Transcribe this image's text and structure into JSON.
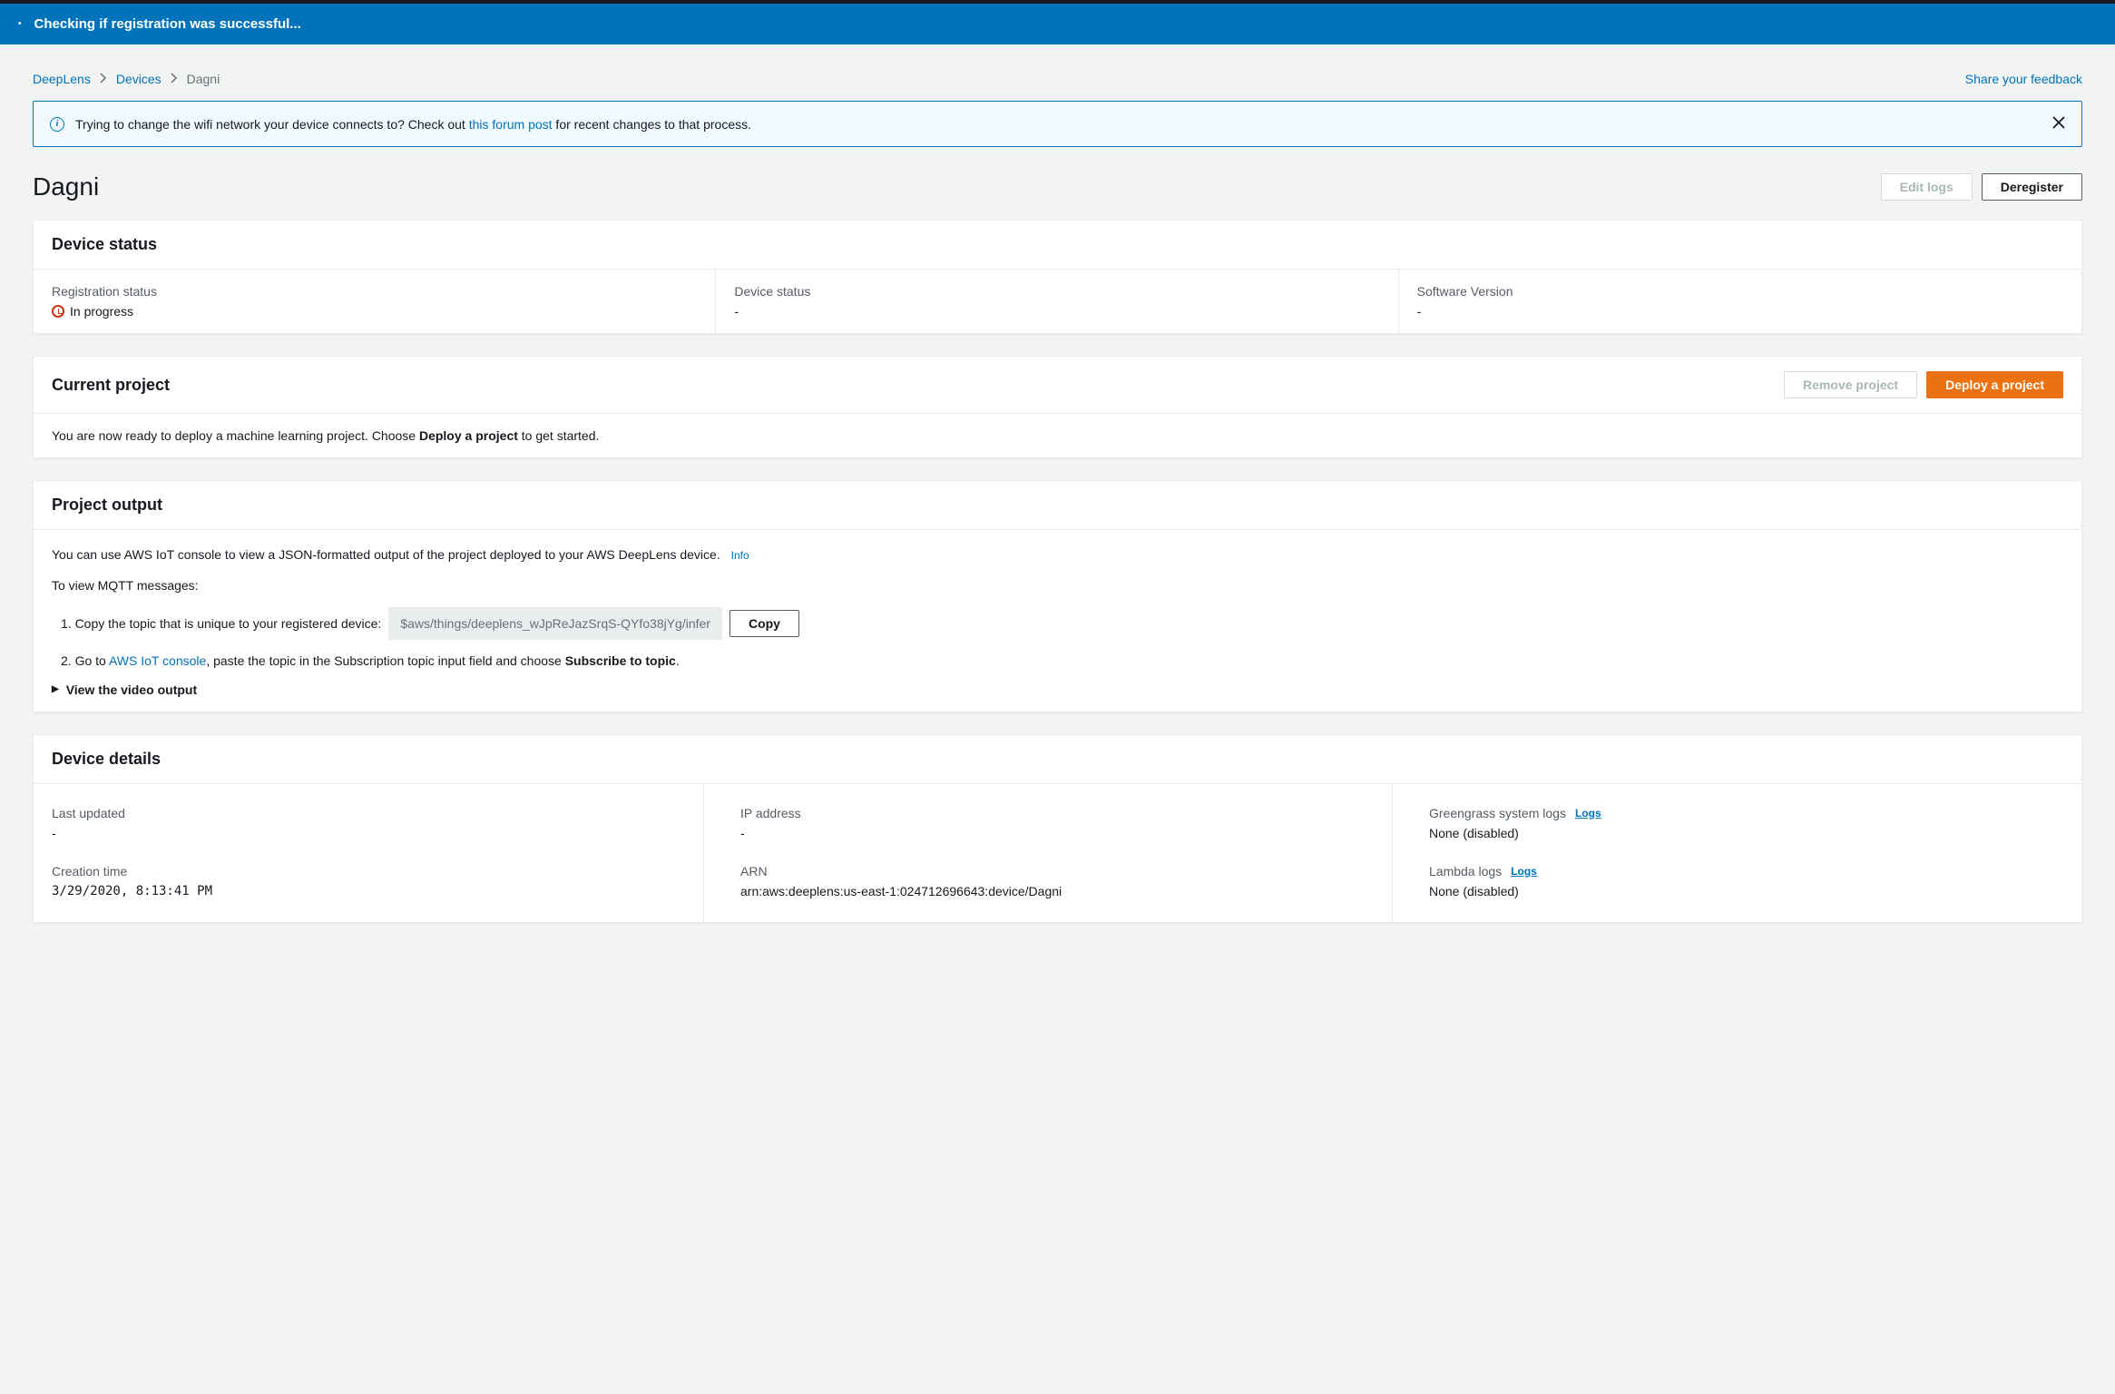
{
  "banner": {
    "message": "Checking if registration was successful..."
  },
  "breadcrumb": {
    "root": "DeepLens",
    "devices": "Devices",
    "current": "Dagni",
    "feedback": "Share your feedback"
  },
  "alert": {
    "text_pre": "Trying to change the wifi network your device connects to? Check out ",
    "link": "this forum post",
    "text_post": " for recent changes to that process."
  },
  "page": {
    "title": "Dagni",
    "edit_logs": "Edit logs",
    "deregister": "Deregister"
  },
  "device_status": {
    "title": "Device status",
    "registration_label": "Registration status",
    "registration_value": "In progress",
    "device_label": "Device status",
    "device_value": "-",
    "software_label": "Software Version",
    "software_value": "-"
  },
  "current_project": {
    "title": "Current project",
    "remove": "Remove project",
    "deploy": "Deploy a project",
    "msg_pre": "You are now ready to deploy a machine learning project. Choose ",
    "msg_bold": "Deploy a project",
    "msg_post": " to get started."
  },
  "project_output": {
    "title": "Project output",
    "intro": "You can use AWS IoT console to view a JSON-formatted output of the project deployed to your AWS DeepLens device.",
    "info": "Info",
    "mqtt_intro": "To view MQTT messages:",
    "step1_pre": "1. Copy the topic that is unique to your registered device:",
    "topic": "$aws/things/deeplens_wJpReJazSrqS-QYfo38jYg/infer",
    "copy": "Copy",
    "step2_pre": "2. Go to ",
    "step2_link": "AWS IoT console",
    "step2_mid": ", paste the topic in the Subscription topic input field and choose ",
    "step2_bold": "Subscribe to topic",
    "step2_end": ".",
    "expand": "View the video output"
  },
  "device_details": {
    "title": "Device details",
    "last_updated_label": "Last updated",
    "last_updated_value": "-",
    "creation_label": "Creation time",
    "creation_value": "3/29/2020, 8:13:41 PM",
    "ip_label": "IP address",
    "ip_value": "-",
    "arn_label": "ARN",
    "arn_value": "arn:aws:deeplens:us-east-1:024712696643:device/Dagni",
    "gg_label": "Greengrass system logs",
    "logs_link": "Logs",
    "gg_value": "None (disabled)",
    "lambda_label": "Lambda logs",
    "lambda_value": "None (disabled)"
  }
}
